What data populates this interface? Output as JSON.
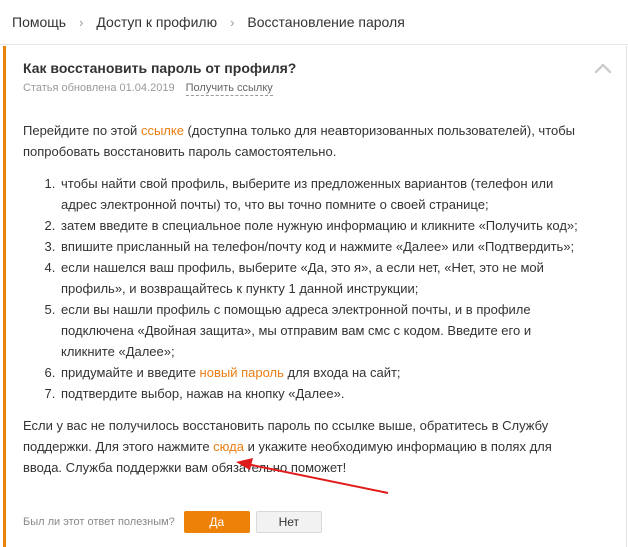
{
  "breadcrumb": {
    "items": [
      "Помощь",
      "Доступ к профилю",
      "Восстановление пароля"
    ],
    "separator": "›"
  },
  "article": {
    "title": "Как восстановить пароль от профиля?",
    "updated": "Статья обновлена 01.04.2019",
    "get_link": "Получить ссылку",
    "intro": {
      "before": "Перейдите по этой ",
      "link": "ссылке",
      "after": " (доступна только для неавторизованных пользователей), чтобы попробовать восстановить пароль самостоятельно."
    },
    "steps": [
      "чтобы найти свой профиль, выберите из предложенных вариантов (телефон или адрес электронной почты) то, что вы точно помните о своей странице;",
      "затем введите в специальное поле нужную информацию и кликните «Получить код»;",
      "впишите присланный на телефон/почту код и нажмите «Далее» или «Подтвердить»;",
      "если нашелся ваш профиль, выберите «Да, это я», а если нет, «Нет, это не мой профиль», и возвращайтесь к пункту 1 данной инструкции;",
      "если вы нашли профиль с помощью адреса электронной почты, и в профиле подключена «Двойная защита», мы отправим вам смс с кодом. Введите его и кликните «Далее»;"
    ],
    "step6": {
      "before": "придумайте и введите ",
      "link": "новый пароль",
      "after": " для входа на сайт;"
    },
    "step7": "подтвердите выбор, нажав на кнопку «Далее».",
    "outro": {
      "before": "Если у вас не получилось восстановить пароль по ссылке выше, обратитесь в Службу поддержки. Для этого нажмите ",
      "link": "сюда",
      "after": " и укажите необходимую информацию в полях для ввода. Служба поддержки вам обязательно поможет!"
    }
  },
  "feedback": {
    "question": "Был ли этот ответ полезным?",
    "yes": "Да",
    "no": "Нет"
  },
  "colors": {
    "accent": "#ee8208",
    "link": "#eb7d12",
    "annotation_arrow": "#e01b1b"
  },
  "icons": {
    "collapse": "chevron-up-icon"
  }
}
